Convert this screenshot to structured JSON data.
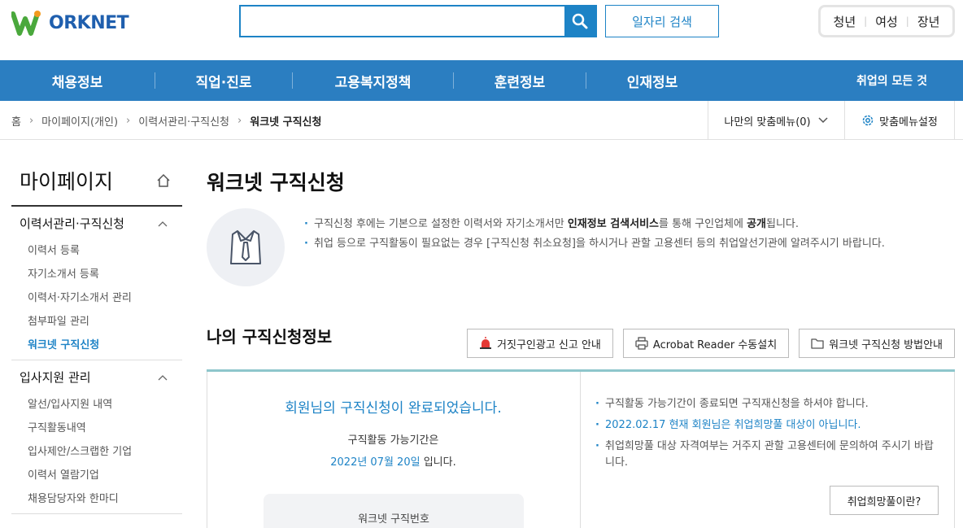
{
  "header": {
    "logo_text": "ORKNET",
    "search": {
      "value": "",
      "placeholder": ""
    },
    "job_search_label": "일자리 검색",
    "quick_links": [
      "청년",
      "여성",
      "장년"
    ]
  },
  "gnb": {
    "items": [
      "채용정보",
      "직업·진로",
      "고용복지정책",
      "훈련정보",
      "인재정보"
    ],
    "right_label": "취업의 모든 것"
  },
  "breadcrumb": {
    "items": [
      "홈",
      "마이페이지(개인)",
      "이력서관리·구직신청",
      "워크넷 구직신청"
    ],
    "my_menu": "나만의 맞춤메뉴(0)",
    "menu_settings": "맞춤메뉴설정"
  },
  "lnb": {
    "title": "마이페이지",
    "groups": [
      {
        "title": "이력서관리·구직신청",
        "items": [
          "이력서 등록",
          "자기소개서 등록",
          "이력서·자기소개서 관리",
          "첨부파일 관리",
          "워크넷 구직신청"
        ]
      },
      {
        "title": "입사지원 관리",
        "items": [
          "알선/입사지원 내역",
          "구직활동내역",
          "입사제안/스크랩한 기업",
          "이력서 열람기업",
          "채용담당자와 한마디"
        ]
      }
    ]
  },
  "main": {
    "title": "워크넷 구직신청",
    "intro": {
      "line1_pre": "구직신청 후에는 기본으로 설정한 이력서와 자기소개서만 ",
      "line1_bold1": "인재정보 검색서비스",
      "line1_mid": "를 통해 구인업체에 ",
      "line1_bold2": "공개",
      "line1_post": "됩니다.",
      "line2": "취업 등으로 구직활동이 필요없는 경우 [구직신청 취소요청]을 하시거나 관할 고용센터 등의 취업알선기관에 알려주시기 바랍니다."
    },
    "section_title": "나의 구직신청정보",
    "buttons": [
      "거짓구인광고 신고 안내",
      "Acrobat Reader 수동설치",
      "워크넷 구직신청 방법안내"
    ],
    "status": {
      "done": "회원님의 구직신청이 완료되었습니다.",
      "period_label": "구직활동 가능기간은",
      "period_date": "2022년 07월 20일",
      "period_suffix": " 입니다.",
      "job_no_label": "워크넷 구직번호"
    },
    "notes": [
      "구직활동 가능기간이 종료되면 구직재신청을 하셔야 합니다.",
      "2022.02.17 현재 회원님은 취업희망풀 대상이 아닙니다.",
      "취업희망풀 대상 자격여부는 거주지 관할 고용센터에 문의하여 주시기 바랍니다."
    ],
    "what_button": "취업희망풀이란?"
  },
  "colors": {
    "brand_blue": "#1d83c6",
    "gnb_blue": "#2b7ec1",
    "logo_green": "#4aa83c"
  }
}
